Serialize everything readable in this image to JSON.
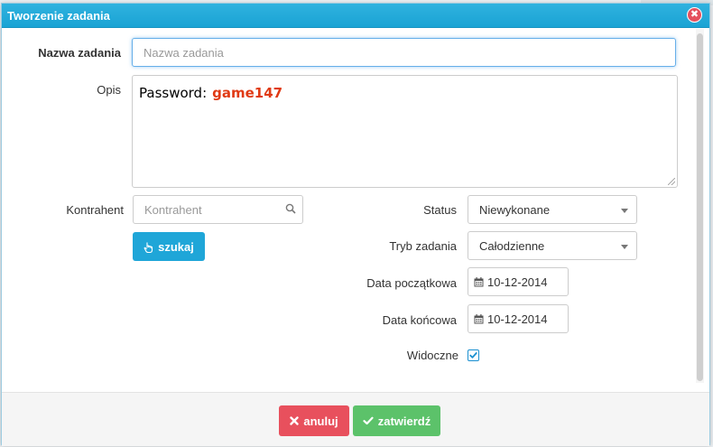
{
  "dialog": {
    "title": "Tworzenie zadania",
    "close_symbol": "✖"
  },
  "form": {
    "task_name": {
      "label": "Nazwa zadania",
      "value": "",
      "placeholder": "Nazwa zadania"
    },
    "description": {
      "label": "Opis",
      "password_label": "Password:",
      "password_value": "game147"
    },
    "contractor": {
      "label": "Kontrahent",
      "value": "",
      "placeholder": "Kontrahent"
    },
    "search_button": {
      "label": "szukaj",
      "icon": "hand-pointer-icon"
    },
    "status": {
      "label": "Status",
      "selected": "Niewykonane"
    },
    "mode": {
      "label": "Tryb zadania",
      "selected": "Całodzienne"
    },
    "start_date": {
      "label": "Data początkowa",
      "value": "10-12-2014",
      "icon": "calendar-icon"
    },
    "end_date": {
      "label": "Data końcowa",
      "value": "10-12-2014",
      "icon": "calendar-icon"
    },
    "visible": {
      "label": "Widoczne",
      "checked": true
    }
  },
  "footer": {
    "cancel_label": "anuluj",
    "confirm_label": "zatwierdź"
  },
  "colors": {
    "titlebar": "#1fa6d8",
    "cancel": "#e8505d",
    "confirm": "#5cc26a",
    "password_value": "#e03a14"
  }
}
